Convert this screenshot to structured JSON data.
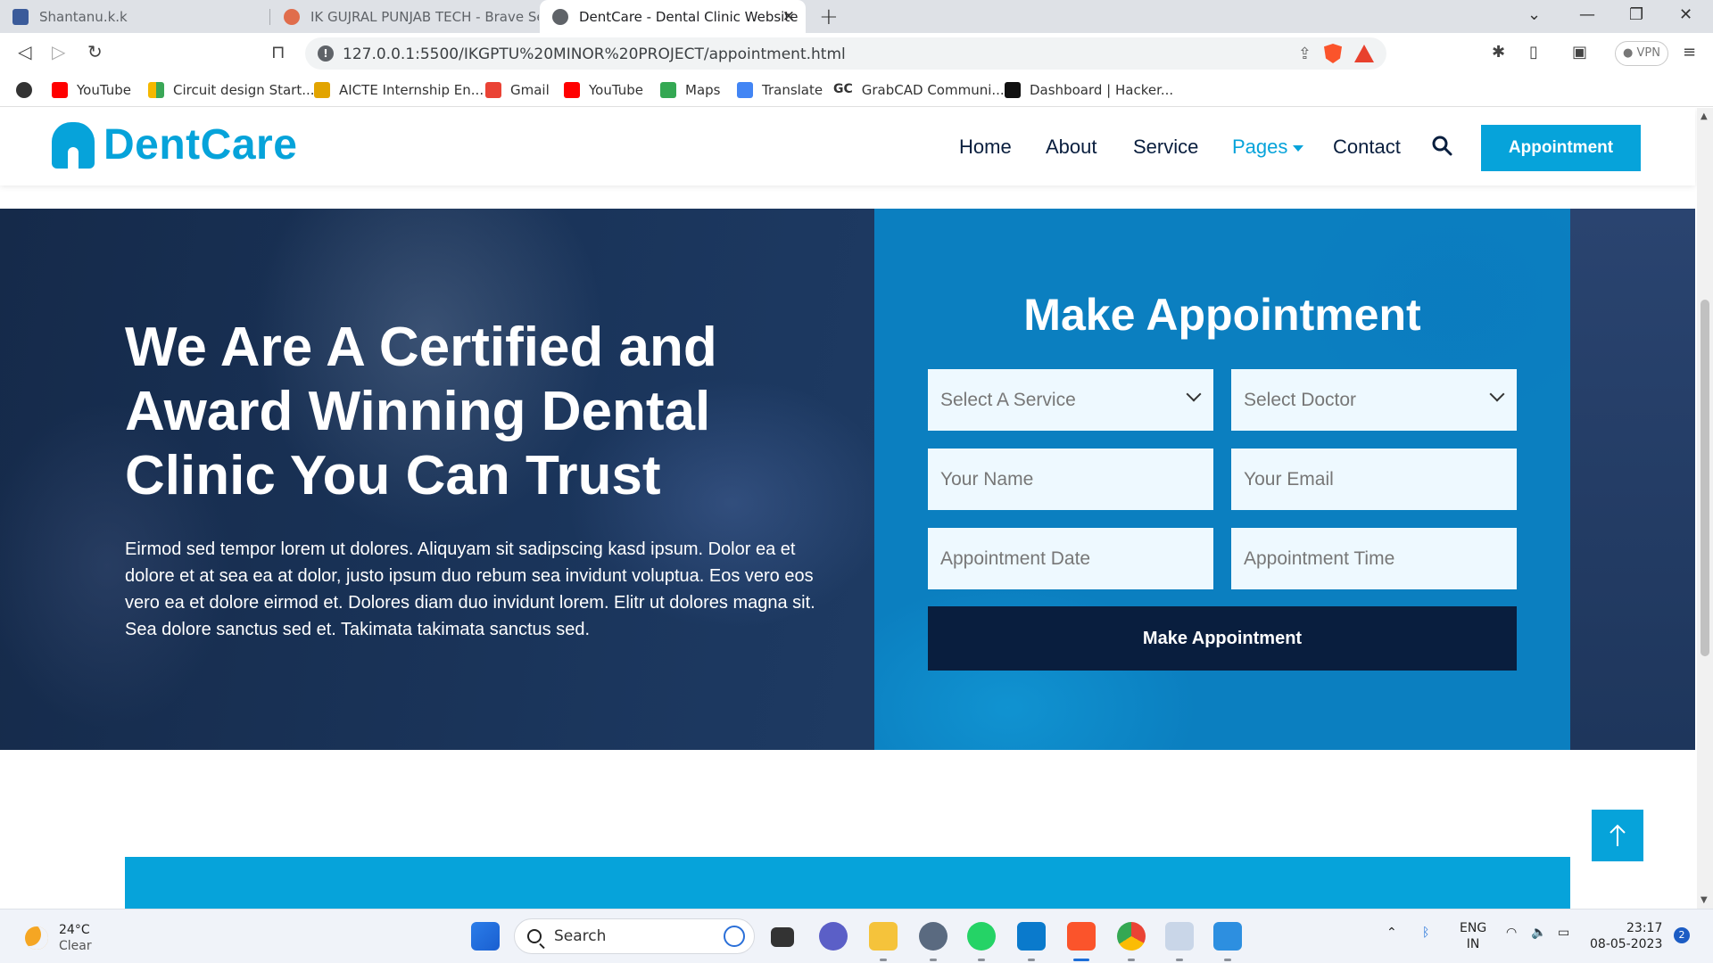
{
  "browser": {
    "tabs": [
      {
        "label": "Shantanu.k.k",
        "active": false
      },
      {
        "label": "IK GUJRAL PUNJAB TECH - Brave Sear",
        "active": false
      },
      {
        "label": "DentCare - Dental Clinic Website",
        "active": true
      }
    ],
    "new_tab": "+",
    "address": "127.0.0.1:5500/IKGPTU%20MINOR%20PROJECT/appointment.html",
    "vpn_label": "VPN",
    "bookmarks": [
      "YouTube",
      "Circuit design Start...",
      "AICTE Internship En...",
      "Gmail",
      "YouTube",
      "Maps",
      "Translate",
      "GrabCAD Communi...",
      "Dashboard | Hacker..."
    ]
  },
  "site": {
    "logo": "DentCare",
    "nav": {
      "home": "Home",
      "about": "About",
      "service": "Service",
      "pages": "Pages",
      "contact": "Contact",
      "appointment": "Appointment"
    },
    "hero": {
      "title": "We Are A Certified and Award Winning Dental Clinic You Can Trust",
      "text": "Eirmod sed tempor lorem ut dolores. Aliquyam sit sadipscing kasd ipsum. Dolor ea et dolore et at sea ea at dolor, justo ipsum duo rebum sea invidunt voluptua. Eos vero eos vero ea et dolore eirmod et. Dolores diam duo invidunt lorem. Elitr ut dolores magna sit. Sea dolore sanctus sed et. Takimata takimata sanctus sed."
    },
    "form": {
      "title": "Make Appointment",
      "service_select": "Select A Service",
      "doctor_select": "Select Doctor",
      "name_placeholder": "Your Name",
      "email_placeholder": "Your Email",
      "date_placeholder": "Appointment Date",
      "time_placeholder": "Appointment Time",
      "submit": "Make Appointment"
    },
    "colors": {
      "primary": "#06a3da",
      "dark": "#091e3e",
      "form_bg": "#0b7fc0"
    }
  },
  "taskbar": {
    "weather_temp": "24°C",
    "weather_desc": "Clear",
    "search": "Search",
    "lang": "ENG",
    "region": "IN",
    "time": "23:17",
    "date": "08-05-2023",
    "notifications": "2"
  }
}
